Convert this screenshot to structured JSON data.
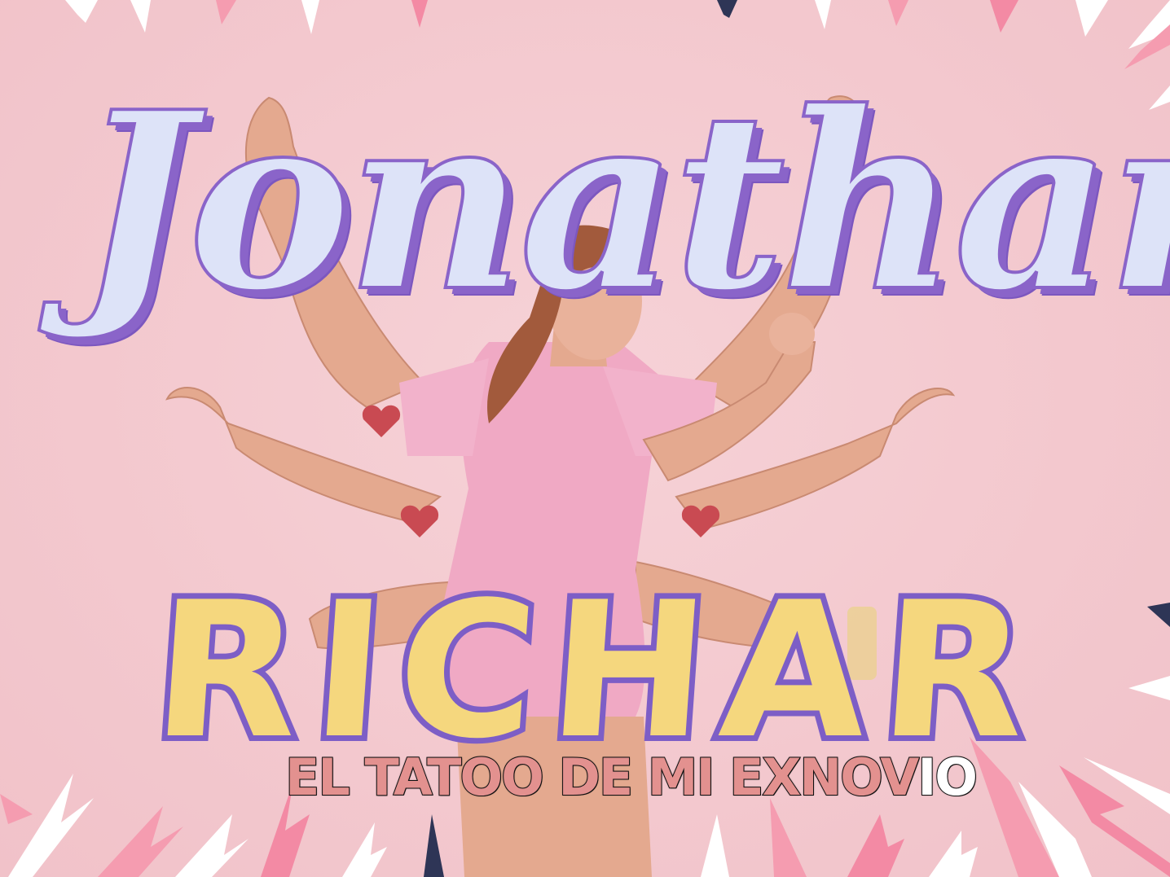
{
  "scene": {
    "title_top": "Jonathan",
    "title_graffiti": "RICHAR",
    "caption_sung": "EL TATOO DE MI EXNOV",
    "caption_unsung": "IO"
  },
  "colors": {
    "background": "#f3c9cf",
    "title_top_fill": "#dde3f8",
    "title_top_shadow": "#8a64c9",
    "graffiti_fill": "#f5d77e",
    "graffiti_outline": "#7d5ec6",
    "caption_sung": "#e3918f",
    "caption_unsung": "#ffffff",
    "shirt": "#f0a9c4",
    "skin": "#e4a98f",
    "hair": "#a25a3c",
    "tattoo_heart": "#c94a52"
  }
}
